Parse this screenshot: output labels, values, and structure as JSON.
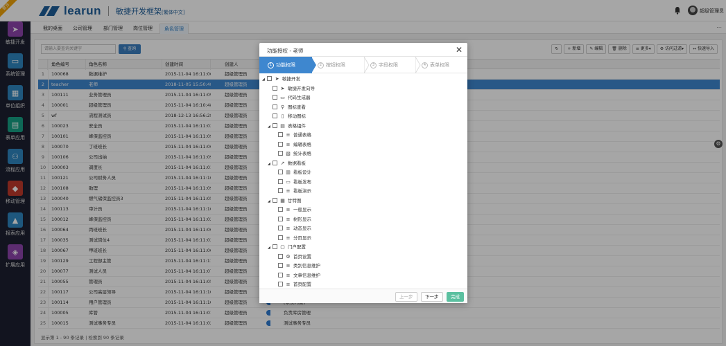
{
  "brand": {
    "ribbon": "官方",
    "logo": "learun",
    "subtitle": "敏捷开发框架",
    "edition": "[繁体中文]",
    "accent": "#1e5e9a"
  },
  "user": {
    "name": "超级管理员"
  },
  "sidebar": [
    {
      "label": "敏捷开发",
      "icon": "paper-plane-icon",
      "color": "#8e44ad",
      "glyph": "➤"
    },
    {
      "label": "系统管理",
      "icon": "monitor-icon",
      "color": "#2e86c1",
      "glyph": "▭"
    },
    {
      "label": "单位组织",
      "icon": "building-icon",
      "color": "#2e86c1",
      "glyph": "▦"
    },
    {
      "label": "表单应用",
      "icon": "table-icon",
      "color": "#16a085",
      "glyph": "▤"
    },
    {
      "label": "流程应用",
      "icon": "share-icon",
      "color": "#2e86c1",
      "glyph": "⚇"
    },
    {
      "label": "移动管理",
      "icon": "android-icon",
      "color": "#c0392b",
      "glyph": "◆"
    },
    {
      "label": "报表应用",
      "icon": "chart-icon",
      "color": "#2e86c1",
      "glyph": "▲"
    },
    {
      "label": "扩展应用",
      "icon": "cube-icon",
      "color": "#8e44ad",
      "glyph": "◈"
    }
  ],
  "tabs": [
    "我的桌面",
    "公司管理",
    "部门管理",
    "岗位管理",
    "角色管理"
  ],
  "search": {
    "placeholder": "请输入要查询关键字",
    "button": "查询"
  },
  "toolbar": [
    "↻",
    "+ 新增",
    "✎ 编辑",
    "🗑 删除",
    "≡ 更多▾",
    "⚙ 访问过滤▾",
    "↔ 快速导入"
  ],
  "grid": {
    "headers": [
      "",
      "角色编号",
      "角色名称",
      "创建时间",
      "创建人"
    ],
    "rows": [
      [
        "1",
        "100068",
        "数据维护",
        "2015-11-04 16:11:06",
        "超级管理员"
      ],
      [
        "2",
        "teacher",
        "老师",
        "2018-11-05 15:50:48",
        "超级管理员"
      ],
      [
        "3",
        "100111",
        "业务管理员",
        "2015-11-04 16:11:09",
        "超级管理员"
      ],
      [
        "4",
        "100001",
        "超级管理员",
        "2015-11-04 16:10:48",
        "超级管理员"
      ],
      [
        "5",
        "wf",
        "流程测试员",
        "2018-12-13 16:56:28",
        "超级管理员"
      ],
      [
        "6",
        "100023",
        "安全员",
        "2015-11-04 16:11:03",
        "超级管理员"
      ],
      [
        "7",
        "100101",
        "峰保监控员",
        "2015-11-04 16:11:09",
        "超级管理员"
      ],
      [
        "8",
        "100070",
        "丁班班长",
        "2015-11-04 16:11:06",
        "超级管理员"
      ],
      [
        "9",
        "100106",
        "公司出纳",
        "2015-11-04 16:11:09",
        "超级管理员"
      ],
      [
        "10",
        "100003",
        "调度长",
        "2015-11-04 16:11:01",
        "超级管理员"
      ],
      [
        "11",
        "100121",
        "公司财务人员",
        "2015-11-04 16:11:10",
        "超级管理员"
      ],
      [
        "12",
        "100108",
        "助理",
        "2015-11-04 16:11:09",
        "超级管理员"
      ],
      [
        "13",
        "100040",
        "燃气储保监控员3",
        "2015-11-04 16:11:05",
        "超级管理员"
      ],
      [
        "14",
        "100113",
        "审计员",
        "2015-11-04 16:11:10",
        "超级管理员"
      ],
      [
        "15",
        "100012",
        "峰保监控员",
        "2015-11-04 16:11:02",
        "超级管理员"
      ],
      [
        "16",
        "100064",
        "丙班班长",
        "2015-11-04 16:11:06",
        "超级管理员"
      ],
      [
        "17",
        "100035",
        "测试岗位4",
        "2015-11-04 16:11:03",
        "超级管理员"
      ],
      [
        "18",
        "100067",
        "甲班班长",
        "2015-11-04 16:11:06",
        "超级管理员"
      ],
      [
        "19",
        "100129",
        "工程部主管",
        "2015-11-04 16:11:11",
        "超级管理员"
      ],
      [
        "20",
        "100077",
        "测试人员",
        "2015-11-04 16:11:07",
        "超级管理员"
      ],
      [
        "21",
        "100055",
        "管理员",
        "2015-11-04 16:11:05",
        "超级管理员"
      ],
      [
        "22",
        "100117",
        "公司高层领导",
        "2015-11-04 16:11:10",
        "超级管理员"
      ],
      [
        "23",
        "100114",
        "用户管理员",
        "2015-11-04 16:11:10",
        "超级管理员"
      ],
      [
        "24",
        "100005",
        "库管",
        "2015-11-04 16:11:01",
        "超级管理员"
      ],
      [
        "25",
        "100015",
        "测试事务专员",
        "2015-11-04 16:11:02",
        "超级管理员"
      ]
    ],
    "remarks": {
      "22": "[系统内置]",
      "23": "负责库房管理",
      "24": "测试事务专员"
    },
    "selected_index": 1
  },
  "pager": "显示第 1 - 90 条记录 | 检索到 90 条记录",
  "dialog": {
    "title": "功能授权 - 老师",
    "steps": [
      {
        "n": "1",
        "label": "功能权限"
      },
      {
        "n": "2",
        "label": "按钮权限"
      },
      {
        "n": "3",
        "label": "字段权限"
      },
      {
        "n": "4",
        "label": "表单权限"
      }
    ],
    "tree": [
      {
        "level": 0,
        "toggle": "◢",
        "icon": "paper-plane-icon",
        "glyph": "➤",
        "label": "敏捷开发"
      },
      {
        "level": 1,
        "toggle": "",
        "icon": "paper-plane-icon",
        "glyph": "➤",
        "label": "敏捷开发向导"
      },
      {
        "level": 1,
        "toggle": "",
        "icon": "monitor-icon",
        "glyph": "▭",
        "label": "代码生成器"
      },
      {
        "level": 1,
        "toggle": "",
        "icon": "search-icon",
        "glyph": "⚲",
        "label": "图标查看"
      },
      {
        "level": 1,
        "toggle": "",
        "icon": "mobile-icon",
        "glyph": "▯",
        "label": "移动图标"
      },
      {
        "level": 1,
        "toggle": "◢",
        "icon": "table-icon",
        "glyph": "▤",
        "label": "表格组件"
      },
      {
        "level": 2,
        "toggle": "",
        "icon": "list-icon",
        "glyph": "≡",
        "label": "普通表格"
      },
      {
        "level": 2,
        "toggle": "",
        "icon": "list-icon",
        "glyph": "≡",
        "label": "编辑表格"
      },
      {
        "level": 2,
        "toggle": "",
        "icon": "file-icon",
        "glyph": "▧",
        "label": "统计表格"
      },
      {
        "level": 1,
        "toggle": "◢",
        "icon": "chart-line-icon",
        "glyph": "↗",
        "label": "数据看板"
      },
      {
        "level": 2,
        "toggle": "",
        "icon": "board-icon",
        "glyph": "▥",
        "label": "看板设计"
      },
      {
        "level": 2,
        "toggle": "",
        "icon": "laptop-icon",
        "glyph": "▭",
        "label": "看板发布"
      },
      {
        "level": 2,
        "toggle": "",
        "icon": "list-icon",
        "glyph": "≡",
        "label": "看板演示"
      },
      {
        "level": 1,
        "toggle": "◢",
        "icon": "gantt-icon",
        "glyph": "▦",
        "label": "甘特图"
      },
      {
        "level": 2,
        "toggle": "",
        "icon": "list-icon",
        "glyph": "≡",
        "label": "一般显示"
      },
      {
        "level": 2,
        "toggle": "",
        "icon": "list-icon",
        "glyph": "≡",
        "label": "树形显示"
      },
      {
        "level": 2,
        "toggle": "",
        "icon": "list-icon",
        "glyph": "≡",
        "label": "动态显示"
      },
      {
        "level": 2,
        "toggle": "",
        "icon": "list-icon",
        "glyph": "≡",
        "label": "分页显示"
      },
      {
        "level": 1,
        "toggle": "◢",
        "icon": "window-icon",
        "glyph": "▢",
        "label": "门户配置"
      },
      {
        "level": 2,
        "toggle": "",
        "icon": "cog-icon",
        "glyph": "⚙",
        "label": "首页设置"
      },
      {
        "level": 2,
        "toggle": "",
        "icon": "list-icon",
        "glyph": "≡",
        "label": "类别信息维护"
      },
      {
        "level": 2,
        "toggle": "",
        "icon": "list-icon",
        "glyph": "≡",
        "label": "文章信息维护"
      },
      {
        "level": 2,
        "toggle": "",
        "icon": "list-icon",
        "glyph": "≡",
        "label": "首页配置"
      }
    ],
    "buttons": {
      "prev": "上一步",
      "next": "下一步",
      "done": "完成"
    }
  }
}
